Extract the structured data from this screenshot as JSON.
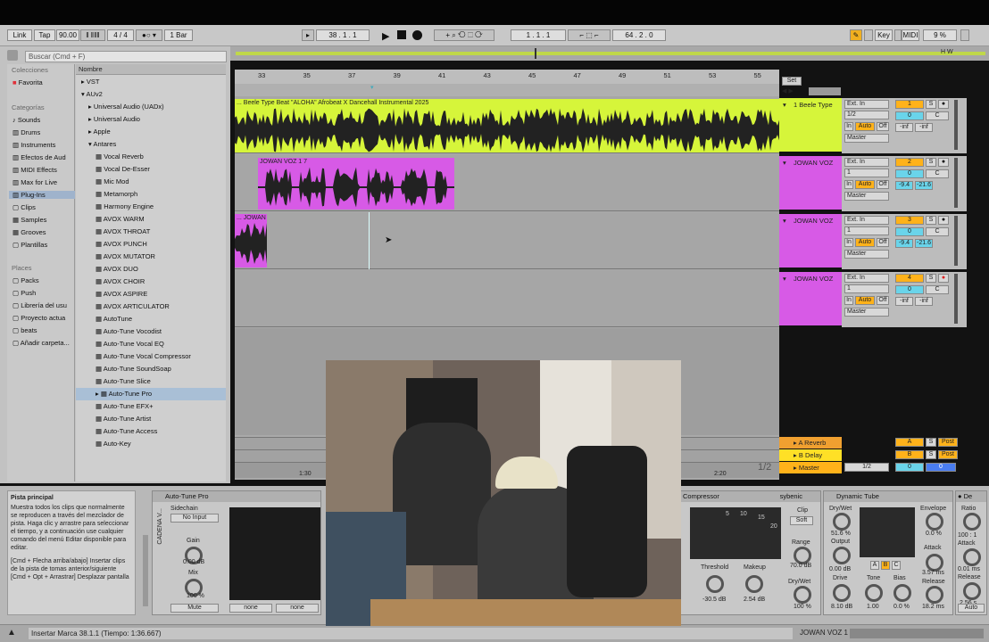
{
  "transport": {
    "link": "Link",
    "tap": "Tap",
    "tempo": "90.00",
    "signature": "4 / 4",
    "quantize": "1 Bar",
    "position": "38 .  1 .  1",
    "loop_start": "1 .  1 .  1",
    "loop_length": "64 .  2 .  0",
    "key": "Key",
    "midi": "MIDI",
    "cpu": "9 %"
  },
  "browser": {
    "search_placeholder": "Buscar (Cmd + F)",
    "collections_header": "Colecciones",
    "favorites": "Favorita",
    "categories_header": "Categorías",
    "categories": [
      "Sounds",
      "Drums",
      "Instruments",
      "Efectos de Aud",
      "MIDI Effects",
      "Max for Live",
      "Plug-Ins",
      "Clips",
      "Samples",
      "Grooves",
      "Plantillas"
    ],
    "places_header": "Places",
    "places": [
      "Packs",
      "Push",
      "Librería del usu",
      "Proyecto actua",
      "beats",
      "Añadir carpeta..."
    ],
    "column_name": "Nombre",
    "tree": [
      "VST",
      "AUv2",
      "Universal Audio (UADx)",
      "Universal Audio",
      "Apple",
      "Antares"
    ],
    "plugins": [
      "Vocal Reverb",
      "Vocal De-Esser",
      "Mic Mod",
      "Metamorph",
      "Harmony Engine",
      "AVOX WARM",
      "AVOX THROAT",
      "AVOX PUNCH",
      "AVOX MUTATOR",
      "AVOX DUO",
      "AVOX CHOIR",
      "AVOX ASPIRE",
      "AVOX ARTICULATOR",
      "AutoTune",
      "Auto-Tune Vocodist",
      "Auto-Tune Vocal EQ",
      "Auto-Tune Vocal Compressor",
      "Auto-Tune SoundSoap",
      "Auto-Tune Slice",
      "Auto-Tune Pro",
      "Auto-Tune EFX+",
      "Auto-Tune Artist",
      "Auto-Tune Access",
      "Auto-Key"
    ],
    "selected_plugin": "Auto-Tune Pro"
  },
  "ruler": {
    "bars": [
      "33",
      "35",
      "37",
      "39",
      "41",
      "43",
      "45",
      "47",
      "49",
      "51",
      "53",
      "55"
    ],
    "time_a": "1:30",
    "time_b": "2:20",
    "page": "1/2",
    "set": "Set"
  },
  "tracks": [
    {
      "name": "1 Beele Type",
      "clip": "... Beele Type Beat \"ALOHA\" Afrobeat X Dancehall Instrumental 2025",
      "input": "Ext. In",
      "channel": "1/2",
      "output": "Master",
      "number": "1",
      "vol": "-inf",
      "pan": "-inf",
      "solo": "S"
    },
    {
      "name": "JOWAN VOZ",
      "clip": "JOWAN VOZ 1 7",
      "input": "Ext. In",
      "channel": "1",
      "output": "Master",
      "number": "2",
      "vol": "-9.4",
      "pan": "-21.6",
      "solo": "S"
    },
    {
      "name": "JOWAN VOZ",
      "clip": "... JOWAN",
      "input": "Ext. In",
      "channel": "1",
      "output": "Master",
      "number": "3",
      "vol": "-9.4",
      "pan": "-21.6",
      "solo": "S"
    },
    {
      "name": "JOWAN VOZ",
      "clip": "",
      "input": "Ext. In",
      "channel": "1",
      "output": "Master",
      "number": "4",
      "vol": "-inf",
      "pan": "-inf",
      "solo": "S"
    }
  ],
  "monitor": {
    "in": "In",
    "auto": "Auto",
    "off": "Off",
    "c": "C",
    "zero": "0"
  },
  "returns": [
    {
      "name": "A Reverb",
      "letter": "A",
      "post": "Post"
    },
    {
      "name": "B Delay",
      "letter": "B",
      "post": "Post"
    },
    {
      "name": "Master",
      "channel": "1/2",
      "zero": "0"
    }
  ],
  "info": {
    "title": "Pista principal",
    "text": "Muestra todos los clips que normalmente se reproducen a través del mezclador de pista. Haga clic y arrastre para seleccionar el tiempo, y a continuación use cualquier comando del menú Editar disponible para editar.",
    "shortcut1": "[Cmd + Flecha arriba/abajo] Insertar clips de la pista de tomas anterior/siguiente",
    "shortcut2": "[Cmd + Opt + Arrastrar] Desplazar pantalla"
  },
  "devices": {
    "autotune": {
      "title": "Auto-Tune Pro",
      "sidechain": "Sidechain",
      "input": "No Input",
      "gain": "Gain",
      "gain_val": "0.00 dB",
      "mix": "Mix",
      "mix_val": "100 %",
      "mute": "Mute",
      "none1": "none",
      "none2": "none",
      "chain": "CADENA V..."
    },
    "compressor": {
      "title": "Compressor",
      "brand": "sybenic",
      "clip": "Clip",
      "soft": "Soft",
      "threshold": "Threshold",
      "threshold_val": "-30.5 dB",
      "makeup": "Makeup",
      "makeup_val": "2.54 dB",
      "range": "Range",
      "range_val": "70.0 dB",
      "drywet": "Dry/Wet",
      "drywet_val": "100 %",
      "scale": [
        "5",
        "10",
        "15",
        "20"
      ]
    },
    "tube": {
      "title": "Dynamic Tube",
      "drywet": "Dry/Wet",
      "drywet_val": "51.6 %",
      "output": "Output",
      "output_val": "0.00 dB",
      "drive": "Drive",
      "drive_val": "8.10 dB",
      "tone": "Tone",
      "tone_val": "1.00",
      "bias": "Bias",
      "bias_val": "0.0 %",
      "envelope": "Envelope",
      "envelope_val": "0.0 %",
      "attack": "Attack",
      "attack_val": "3.57 ms",
      "release": "Release",
      "release_val": "18.2 ms",
      "abc": [
        "A",
        "B",
        "C"
      ]
    },
    "extra": {
      "ratio": "Ratio",
      "ratio_val": "100 : 1",
      "attack": "Attack",
      "attack_val": "0.01 ms",
      "release": "Release",
      "release_val": "2.56 s",
      "auto": "Auto"
    }
  },
  "status": {
    "message": "Insertar Marca 38.1.1 (Tiempo: 1:36.667)",
    "track": "JOWAN VOZ 1"
  },
  "colors": {
    "lime": "#d6f53a",
    "magenta": "#d75ae6",
    "orange": "#ffb21a",
    "cyan": "#6ad4ea"
  }
}
